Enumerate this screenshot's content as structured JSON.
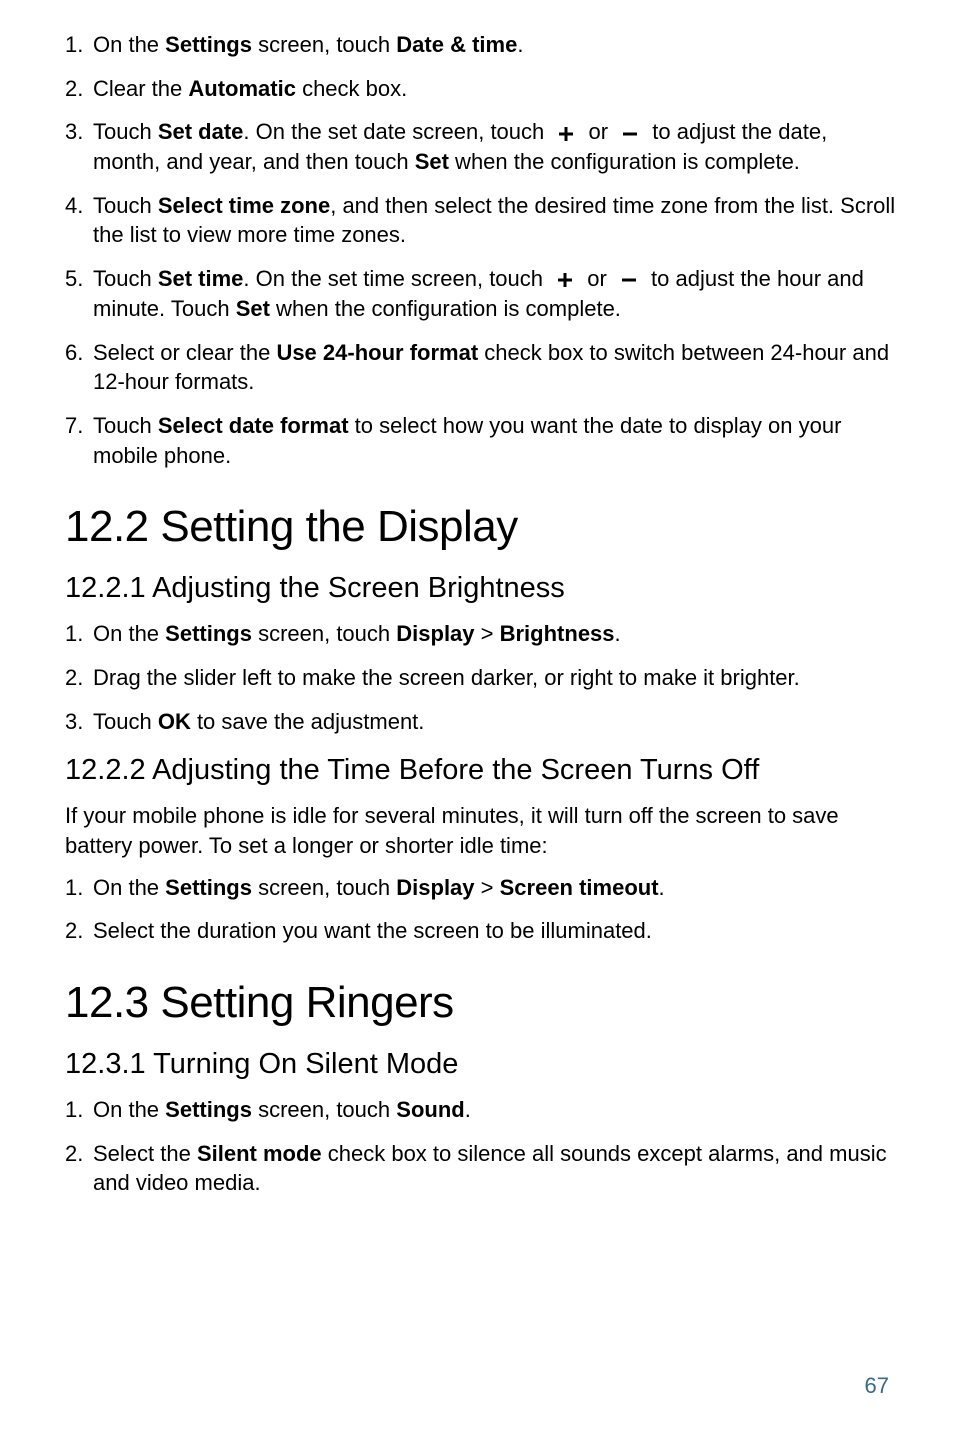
{
  "section_intro": {
    "items": [
      {
        "num": "1.",
        "pre": "On the ",
        "b1": "Settings",
        "t1": " screen, touch ",
        "b2": "Date & time",
        "t2": "."
      },
      {
        "num": "2.",
        "pre": "Clear the ",
        "b1": "Automatic",
        "t1": " check box."
      },
      {
        "num": "3.",
        "pre": "Touch ",
        "b1": "Set date",
        "t1": ". On the set date screen, touch ",
        "icon1": "plus",
        "mid1": "  or ",
        "icon2": "minus",
        "t2": "  to adjust the date, month, and year, and then touch ",
        "b2": "Set",
        "t3": " when the configuration is complete."
      },
      {
        "num": "4.",
        "pre": "Touch ",
        "b1": "Select time zone",
        "t1": ", and then select the desired time zone from the list. Scroll the list to view more time zones."
      },
      {
        "num": "5.",
        "pre": "Touch ",
        "b1": "Set time",
        "t1": ". On the set time screen, touch ",
        "icon1": "plus",
        "mid1": "  or ",
        "icon2": "minus",
        "t2": "  to adjust the hour and minute. Touch ",
        "b2": "Set",
        "t3": " when the configuration is complete."
      },
      {
        "num": "6.",
        "pre": "Select or clear the ",
        "b1": "Use 24-hour format",
        "t1": " check box to switch between 24-hour and 12-hour formats."
      },
      {
        "num": "7.",
        "pre": "Touch ",
        "b1": "Select date format",
        "t1": " to select how you want the date to display on your mobile phone."
      }
    ]
  },
  "h12_2": "12.2  Setting the Display",
  "s12_2_1": {
    "heading": "12.2.1  Adjusting the Screen Brightness",
    "items": [
      {
        "num": "1.",
        "pre": "On the ",
        "b1": "Settings",
        "t1": " screen, touch ",
        "b2": "Display",
        "gt": " > ",
        "b3": "Brightness",
        "t2": "."
      },
      {
        "num": "2.",
        "pre": "Drag the slider left to make the screen darker, or right to make it brighter."
      },
      {
        "num": "3.",
        "pre": "Touch ",
        "b1": "OK",
        "t1": " to save the adjustment."
      }
    ]
  },
  "s12_2_2": {
    "heading": "12.2.2  Adjusting the Time Before the Screen Turns Off",
    "para": "If your mobile phone is idle for several minutes, it will turn off the screen to save battery power. To set a longer or shorter idle time:",
    "items": [
      {
        "num": "1.",
        "pre": "On the ",
        "b1": "Settings",
        "t1": " screen, touch ",
        "b2": "Display",
        "gt": " > ",
        "b3": "Screen timeout",
        "t2": "."
      },
      {
        "num": "2.",
        "pre": "Select the duration you want the screen to be illuminated."
      }
    ]
  },
  "h12_3": "12.3  Setting Ringers",
  "s12_3_1": {
    "heading": "12.3.1  Turning On Silent Mode",
    "items": [
      {
        "num": "1.",
        "pre": "On the ",
        "b1": "Settings",
        "t1": " screen, touch ",
        "b2": "Sound",
        "t2": "."
      },
      {
        "num": "2.",
        "pre": "Select the ",
        "b1": "Silent mode",
        "t1": " check box to silence all sounds except alarms, and music and video media."
      }
    ]
  },
  "pagenum": "67"
}
